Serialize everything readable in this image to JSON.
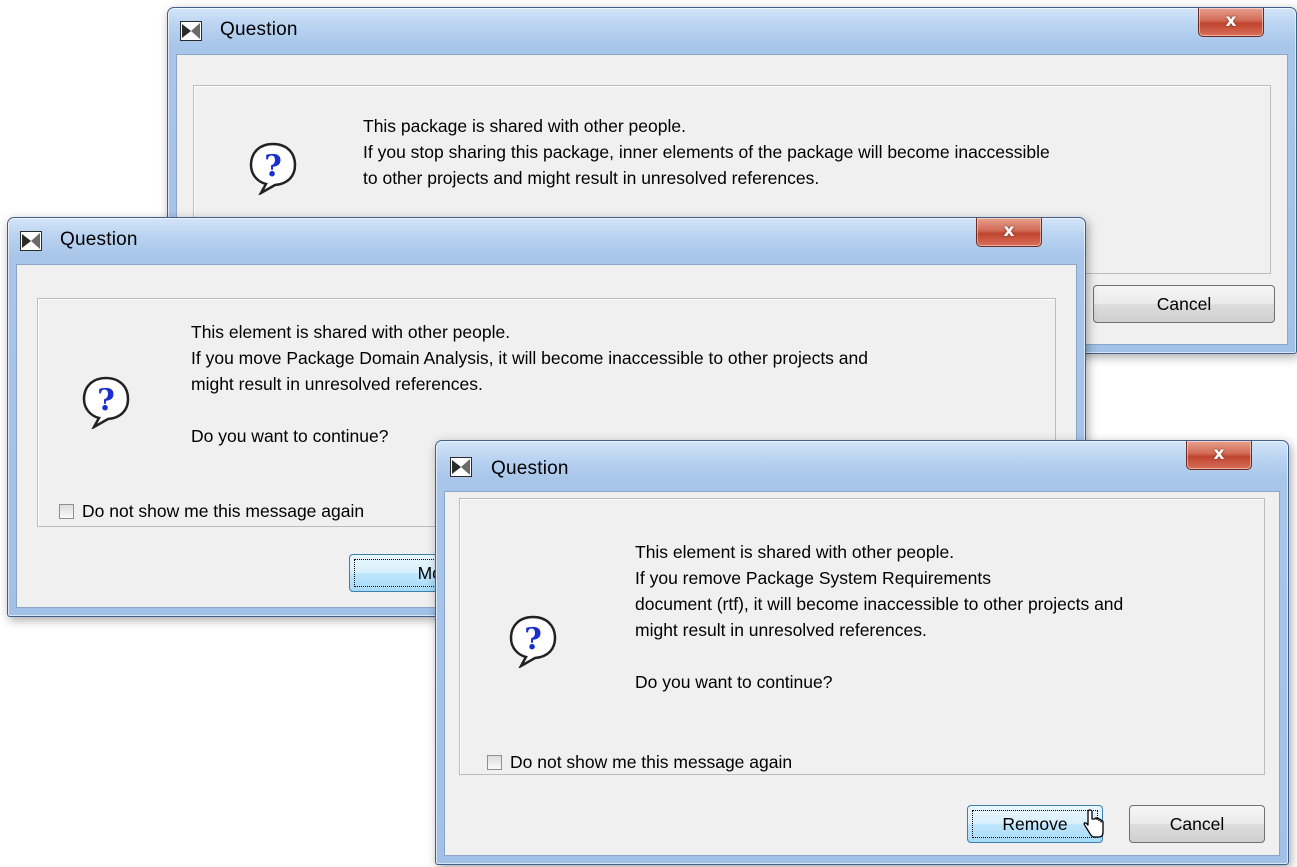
{
  "dialogs": [
    {
      "title": "Question",
      "close_symbol": "x",
      "message_lines": [
        "This package is shared with other people.",
        "If you stop sharing this package, inner elements of the package will become inaccessible",
        "to other projects and might result in unresolved references."
      ],
      "buttons": {
        "cancel": "Cancel"
      }
    },
    {
      "title": "Question",
      "close_symbol": "x",
      "message_lines": [
        "This element is shared with other people.",
        "If you move Package Domain Analysis, it will become inaccessible to other projects and",
        "might result in unresolved references.",
        "",
        "Do you want to continue?"
      ],
      "checkbox_label": "Do not show me this message again",
      "buttons": {
        "primary": "Move"
      }
    },
    {
      "title": "Question",
      "close_symbol": "x",
      "message_lines": [
        "This element is shared with other people.",
        "If you remove Package System Requirements",
        "document (rtf), it will become inaccessible to other projects and",
        "might result in unresolved references.",
        "",
        "Do you want to continue?"
      ],
      "checkbox_label": "Do not show me this message again",
      "buttons": {
        "primary": "Remove",
        "cancel": "Cancel"
      }
    }
  ],
  "icons": {
    "app": "app-icon",
    "question": "question-icon",
    "close": "close-icon",
    "cursor": "pointer-cursor-icon"
  },
  "colors": {
    "title_bar": "#a8c6ea",
    "close_button": "#c9553f",
    "client_bg": "#f0f0f0",
    "question_mark": "#1a2fd0",
    "default_button": "#bee6fd"
  }
}
